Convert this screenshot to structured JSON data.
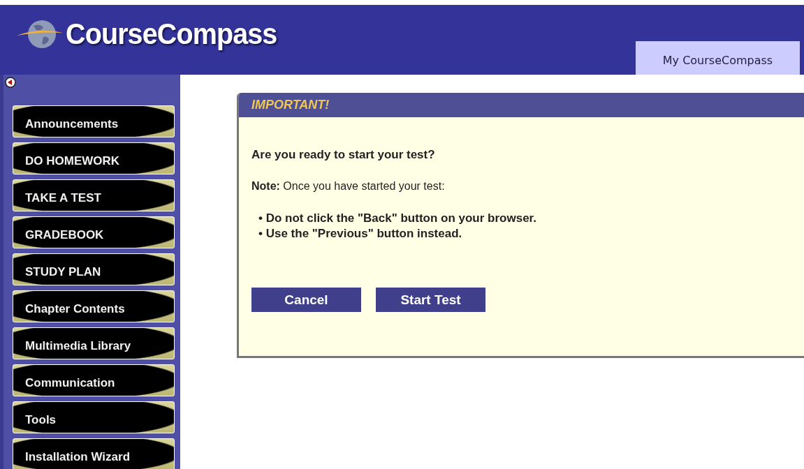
{
  "header": {
    "logo": "CourseCompass",
    "tabs": [
      {
        "label": "My CourseCompass",
        "selected": true
      }
    ]
  },
  "sidebar": {
    "items": [
      {
        "label": "Announcements"
      },
      {
        "label": "DO HOMEWORK"
      },
      {
        "label": "TAKE A TEST"
      },
      {
        "label": "GRADEBOOK"
      },
      {
        "label": "STUDY PLAN"
      },
      {
        "label": "Chapter Contents"
      },
      {
        "label": "Multimedia Library"
      },
      {
        "label": "Communication"
      },
      {
        "label": "Tools"
      },
      {
        "label": "Installation Wizard"
      }
    ]
  },
  "dialog": {
    "title": "IMPORTANT!",
    "question": "Are you ready to start your test?",
    "note": "**Note:** Once you have started your test:",
    "bullets": [
      "• Do not click the \"Back\" button on your browser.",
      "• Use the \"Previous\" button instead."
    ],
    "buttons": [
      "Cancel",
      "Start Test"
    ]
  }
}
